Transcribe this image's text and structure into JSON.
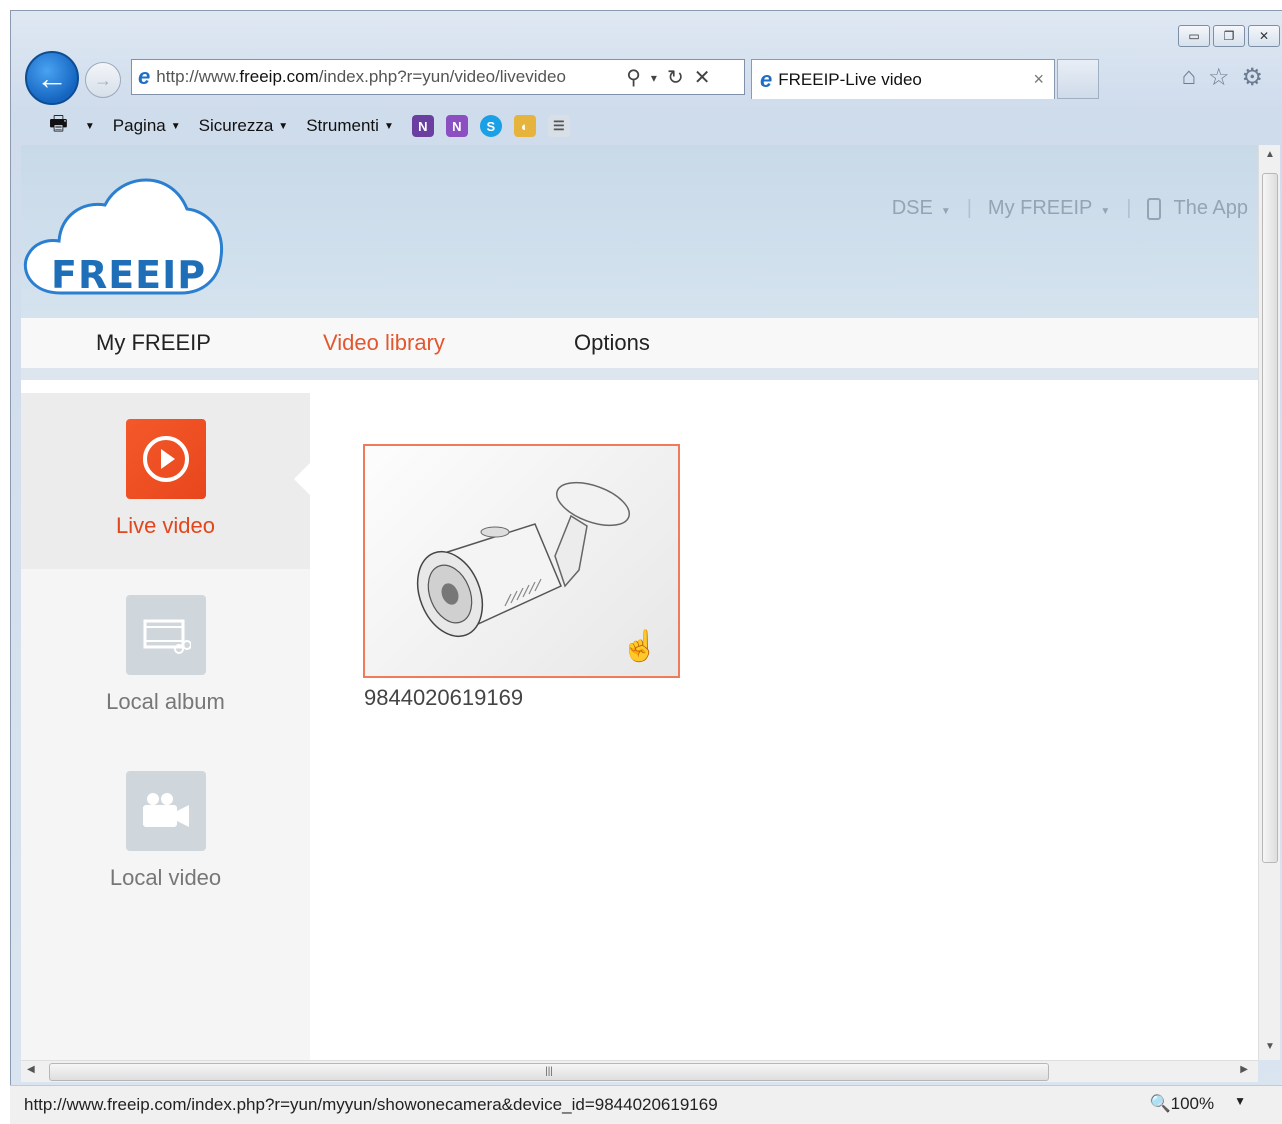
{
  "browser": {
    "url_prefix": "http://www.",
    "url_domain": "freeip.com",
    "url_suffix": "/index.php?r=yun/video/livevideo",
    "tab_title": "FREEIP-Live video",
    "tab_close": "×",
    "command_bar": {
      "pagina": "Pagina",
      "sicurezza": "Sicurezza",
      "strumenti": "Strumenti"
    },
    "status_url": "http://www.freeip.com/index.php?r=yun/myyun/showonecamera&device_id=9844020619169",
    "zoom": "100%"
  },
  "header": {
    "logo": "FREEIP",
    "links": {
      "dse": "DSE",
      "my_freeip": "My FREEIP",
      "the_app": "The App"
    }
  },
  "nav": {
    "my_freeip": "My FREEIP",
    "video_library": "Video library",
    "options": "Options"
  },
  "sidebar": {
    "live_video": "Live video",
    "local_album": "Local album",
    "local_video": "Local video"
  },
  "camera": {
    "device_id": "9844020619169"
  },
  "colors": {
    "accent": "#e2572f",
    "header_bg": "#c8d9e8",
    "logo_blue": "#1f6fb8"
  }
}
